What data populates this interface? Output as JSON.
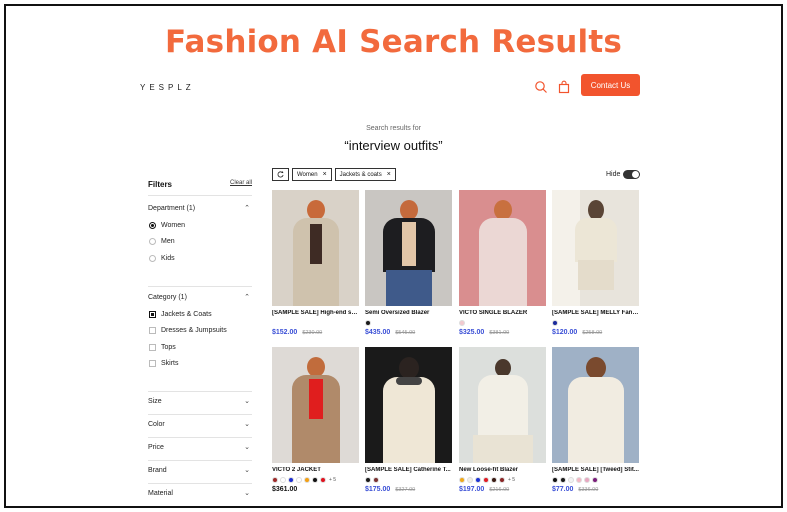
{
  "banner": "Fashion AI Search Results",
  "header": {
    "logo": "YESPLZ",
    "contact_label": "Contact Us"
  },
  "search": {
    "subtitle": "Search results for",
    "query": "“interview outfits”"
  },
  "filters": {
    "title": "Filters",
    "clear_label": "Clear all",
    "department": {
      "label": "Department (1)",
      "options": [
        "Women",
        "Men",
        "Kids"
      ]
    },
    "category": {
      "label": "Category (1)",
      "options": [
        "Jackets & Coats",
        "Dresses & Jumpsuits",
        "Tops",
        "Skirts"
      ]
    },
    "collapsed": [
      "Size",
      "Color",
      "Price",
      "Brand",
      "Material"
    ]
  },
  "chips": [
    "Women",
    "Jackets & coats"
  ],
  "hide_label": "Hide",
  "products": [
    {
      "name": "[SAMPLE SALE] High-end su...",
      "price": "$152.00",
      "old": "$230.00",
      "colors": [],
      "more": "",
      "sale": true
    },
    {
      "name": "Semi Oversized Blazer",
      "price": "$435.00",
      "old": "$545.00",
      "colors": [
        "#1a1a1a"
      ],
      "more": "",
      "sale": true
    },
    {
      "name": "VICTO SINGLE BLAZER",
      "price": "$325.00",
      "old": "$381.00",
      "colors": [
        "#f2c9cf"
      ],
      "more": "",
      "sale": true
    },
    {
      "name": "[SAMPLE SALE] MELLY Fanc...",
      "price": "$120.00",
      "old": "$258.00",
      "colors": [
        "#1b2a9c"
      ],
      "more": "",
      "sale": true
    },
    {
      "name": "VICTO 2 JACKET",
      "price": "$361.00",
      "old": "",
      "colors": [
        "#9e2a2a",
        "#ffffff",
        "#1e2fd1",
        "#ffffff",
        "#f4a012",
        "#111111",
        "#e0121f"
      ],
      "more": "+ 5",
      "sale": false
    },
    {
      "name": "[SAMPLE SALE] Catherine T...",
      "price": "$175.00",
      "old": "$327.00",
      "colors": [
        "#1a1a1a",
        "#7a3030"
      ],
      "more": "",
      "sale": true
    },
    {
      "name": "New Loose-fit Blazer",
      "price": "$197.00",
      "old": "$216.00",
      "colors": [
        "#f0a818",
        "#f2efe6",
        "#1d33d3",
        "#e01b25",
        "#3a1a12",
        "#8a2525"
      ],
      "more": "+ 5",
      "sale": true
    },
    {
      "name": "[SAMPLE SALE] [Tweed] Stit...",
      "price": "$77.00",
      "old": "$336.00",
      "colors": [
        "#111111",
        "#1a1a1a",
        "#f3f3f3",
        "#f3b7c4",
        "#e8a6c0",
        "#7a1d7a"
      ],
      "more": "",
      "sale": true
    }
  ],
  "colors": {
    "accent": "#f2542d",
    "banner": "#f26a3d",
    "sale_price": "#3a4fd6"
  },
  "icons": [
    "search-icon",
    "bag-icon",
    "chevron-up-icon",
    "chevron-down-icon",
    "close-icon",
    "refresh-icon"
  ]
}
